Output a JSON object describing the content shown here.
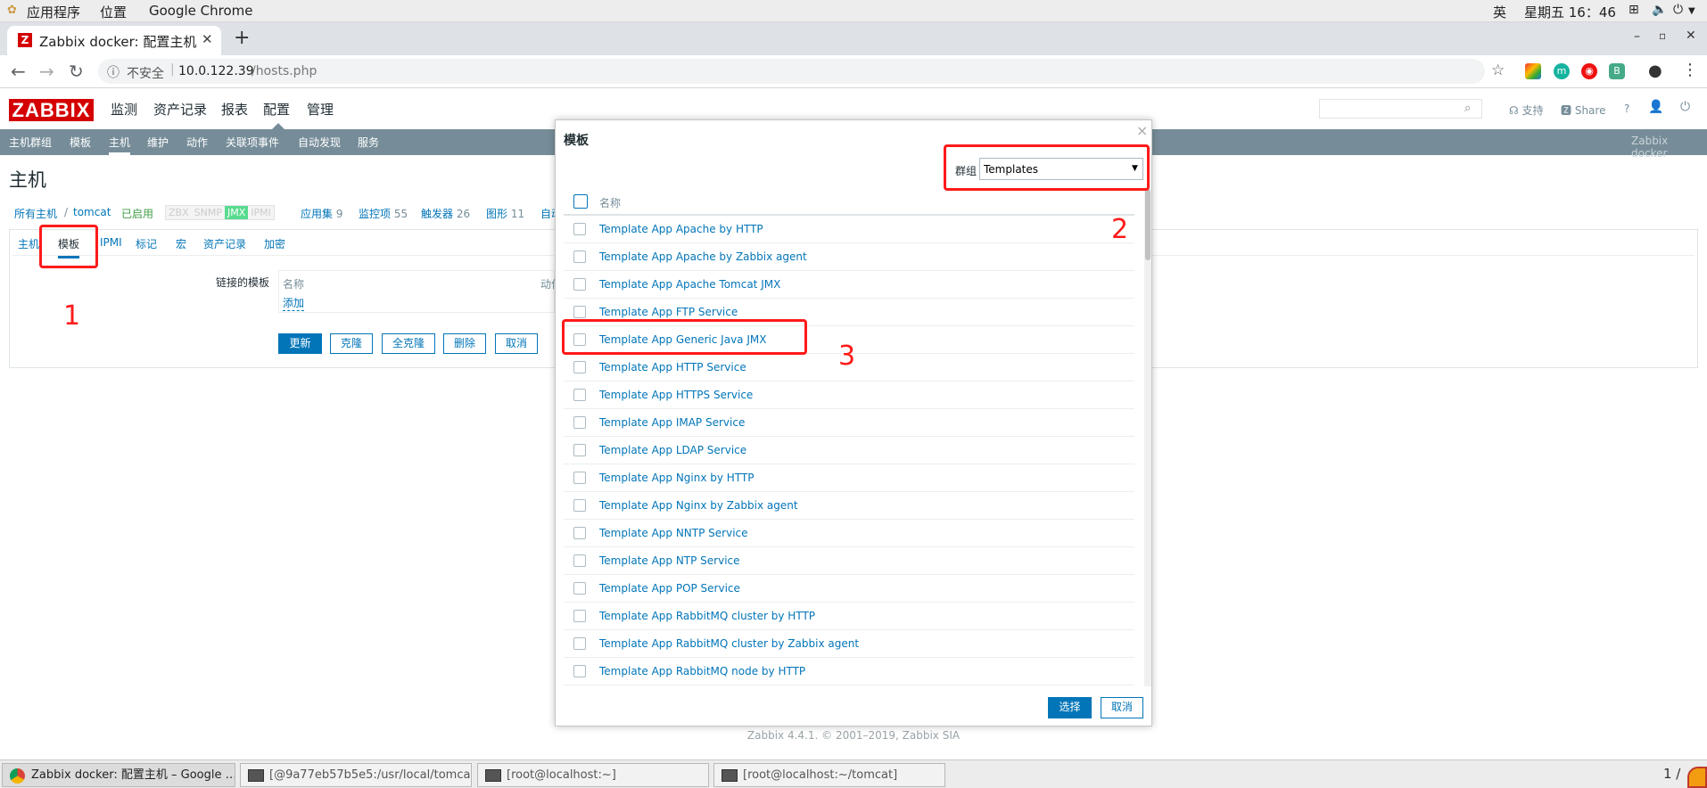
{
  "gnome": {
    "apps": "应用程序",
    "places": "位置",
    "app_name": "Google Chrome",
    "ime": "英",
    "clock": "星期五 16：46"
  },
  "browser": {
    "tab_title": "Zabbix docker: 配置主机",
    "security": "不安全",
    "url_host": "10.0.122.39",
    "url_path": "/hosts.php"
  },
  "zabbix": {
    "logo": "ZABBIX",
    "main_menu": [
      "监测",
      "资产记录",
      "报表",
      "配置",
      "管理"
    ],
    "header_links": {
      "support": "支持",
      "share": "Share",
      "help": "?"
    },
    "sub_menu": [
      "主机群组",
      "模板",
      "主机",
      "维护",
      "动作",
      "关联项事件",
      "自动发现",
      "服务"
    ],
    "server_name": "Zabbix docker",
    "page_title": "主机",
    "breadcrumb": {
      "all_hosts": "所有主机",
      "sep": "/",
      "host": "tomcat",
      "status": "已启用"
    },
    "availability": [
      "ZBX",
      "SNMP",
      "JMX",
      "IPMI"
    ],
    "host_stats": [
      {
        "label": "应用集",
        "count": "9"
      },
      {
        "label": "监控项",
        "count": "55"
      },
      {
        "label": "触发器",
        "count": "26"
      },
      {
        "label": "图形",
        "count": "11"
      },
      {
        "label": "自动",
        "count": ""
      }
    ],
    "tabs": [
      "主机",
      "模板",
      "IPMI",
      "标记",
      "宏",
      "资产记录",
      "加密"
    ],
    "linked_templates_label": "链接的模板",
    "col_name": "名称",
    "col_action": "动作",
    "add_link": "添加",
    "buttons": [
      "更新",
      "克隆",
      "全克隆",
      "删除",
      "取消"
    ],
    "footer": "Zabbix 4.4.1. © 2001–2019, Zabbix SIA"
  },
  "modal": {
    "title": "模板",
    "close": "×",
    "group_label": "群组",
    "group_value": "Templates",
    "header_col": "名称",
    "items": [
      "Template App Apache by HTTP",
      "Template App Apache by Zabbix agent",
      "Template App Apache Tomcat JMX",
      "Template App FTP Service",
      "Template App Generic Java JMX",
      "Template App HTTP Service",
      "Template App HTTPS Service",
      "Template App IMAP Service",
      "Template App LDAP Service",
      "Template App Nginx by HTTP",
      "Template App Nginx by Zabbix agent",
      "Template App NNTP Service",
      "Template App NTP Service",
      "Template App POP Service",
      "Template App RabbitMQ cluster by HTTP",
      "Template App RabbitMQ cluster by Zabbix agent",
      "Template App RabbitMQ node by HTTP"
    ],
    "select_btn": "选择",
    "cancel_btn": "取消"
  },
  "annotations": [
    "1",
    "2",
    "3"
  ],
  "taskbar": {
    "items": [
      "Zabbix docker: 配置主机 – Google …",
      "[@9a77eb57b5e5:/usr/local/tomca…",
      "[root@localhost:~]",
      "[root@localhost:~/tomcat]"
    ],
    "pager": "1 /"
  },
  "colors": {
    "zabbix_red": "#d40000",
    "subnav": "#768d99",
    "link": "#0275b8",
    "annotation": "#ff1a1a"
  }
}
